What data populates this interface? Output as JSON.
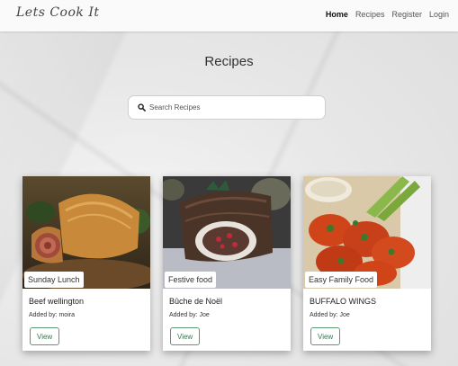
{
  "nav": {
    "logo": "Lets Cook It",
    "links": [
      "Home",
      "Recipes",
      "Register",
      "Login"
    ]
  },
  "page": {
    "title": "Recipes"
  },
  "search": {
    "placeholder": "Search Recipes"
  },
  "recipes": [
    {
      "tag": "Sunday Lunch",
      "title": "Beef wellington",
      "author": "Added by: moira",
      "button": "View"
    },
    {
      "tag": "Festive food",
      "title": "Bûche de Noël",
      "author": "Added by: Joe",
      "button": "View"
    },
    {
      "tag": "Easy Family Food",
      "title": "BUFFALO WINGS",
      "author": "Added by: Joe",
      "button": "View"
    }
  ],
  "colors": {
    "button_text": "#2f7a4e",
    "button_border": "#5a9a72"
  }
}
